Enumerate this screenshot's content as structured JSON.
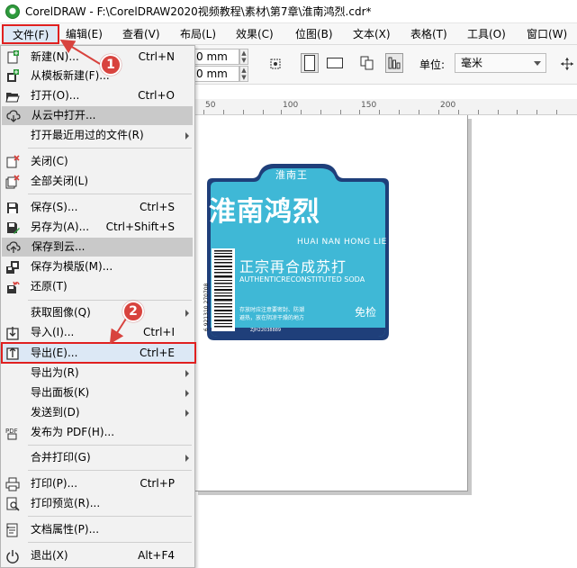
{
  "window": {
    "title": "CorelDRAW - F:\\CorelDRAW2020视频教程\\素材\\第7章\\淮南鸿烈.cdr*"
  },
  "menubar": {
    "items": [
      {
        "label": "文件(F)"
      },
      {
        "label": "编辑(E)"
      },
      {
        "label": "查看(V)"
      },
      {
        "label": "布局(L)"
      },
      {
        "label": "效果(C)"
      },
      {
        "label": "位图(B)"
      },
      {
        "label": "文本(X)"
      },
      {
        "label": "表格(T)"
      },
      {
        "label": "工具(O)"
      },
      {
        "label": "窗口(W)"
      }
    ]
  },
  "toolbar": {
    "width_value": "0 mm",
    "height_value": "0 mm",
    "unit_label": "单位:",
    "unit_value": "毫米"
  },
  "ruler": {
    "labels": [
      "50",
      "100",
      "150",
      "200"
    ]
  },
  "file_menu": {
    "items": [
      {
        "label": "新建(N)...",
        "shortcut": "Ctrl+N",
        "icon": "new-document-icon"
      },
      {
        "label": "从模板新建(F)...",
        "shortcut": "",
        "icon": "new-from-template-icon"
      },
      {
        "label": "打开(O)...",
        "shortcut": "Ctrl+O",
        "icon": "open-folder-icon"
      },
      {
        "label": "从云中打开...",
        "shortcut": "",
        "icon": "cloud-download-icon"
      },
      {
        "label": "打开最近用过的文件(R)",
        "shortcut": "",
        "icon": ""
      },
      {
        "label": "关闭(C)",
        "shortcut": "",
        "icon": "close-document-icon"
      },
      {
        "label": "全部关闭(L)",
        "shortcut": "",
        "icon": "close-all-icon"
      },
      {
        "label": "保存(S)...",
        "shortcut": "Ctrl+S",
        "icon": "save-icon"
      },
      {
        "label": "另存为(A)...",
        "shortcut": "Ctrl+Shift+S",
        "icon": "save-as-icon"
      },
      {
        "label": "保存到云...",
        "shortcut": "",
        "icon": "cloud-upload-icon"
      },
      {
        "label": "保存为模版(M)...",
        "shortcut": "",
        "icon": "save-template-icon"
      },
      {
        "label": "还原(T)",
        "shortcut": "",
        "icon": "revert-icon"
      },
      {
        "label": "获取图像(Q)",
        "shortcut": "",
        "icon": ""
      },
      {
        "label": "导入(I)...",
        "shortcut": "Ctrl+I",
        "icon": "import-icon"
      },
      {
        "label": "导出(E)...",
        "shortcut": "Ctrl+E",
        "icon": "export-icon"
      },
      {
        "label": "导出为(R)",
        "shortcut": "",
        "icon": ""
      },
      {
        "label": "导出面板(K)",
        "shortcut": "",
        "icon": ""
      },
      {
        "label": "发送到(D)",
        "shortcut": "",
        "icon": ""
      },
      {
        "label": "发布为 PDF(H)...",
        "shortcut": "",
        "icon": "pdf-icon"
      },
      {
        "label": "合并打印(G)",
        "shortcut": "",
        "icon": ""
      },
      {
        "label": "打印(P)...",
        "shortcut": "Ctrl+P",
        "icon": "print-icon"
      },
      {
        "label": "打印预览(R)...",
        "shortcut": "",
        "icon": "print-preview-icon"
      },
      {
        "label": "文档属性(P)...",
        "shortcut": "",
        "icon": "document-properties-icon"
      },
      {
        "label": "退出(X)",
        "shortcut": "Alt+F4",
        "icon": "exit-icon"
      }
    ]
  },
  "callouts": {
    "step1": "1",
    "step2": "2"
  },
  "artwork": {
    "brand_small": "淮南王",
    "brand_big": "淮南鸿烈",
    "pinyin": "HUAI NAN HONG LIE",
    "slogan": "正宗再合成苏打",
    "slogan_en": "AUTHENTICRECONSTITUTED SODA",
    "notice": "存放时应注意要密封、防潮\n避热，放在阴凉干燥的地方",
    "badge": "免检",
    "license": "ZJH22038889",
    "barcode_number": "6 921310 270708"
  },
  "colors": {
    "accent_red": "#e02020",
    "badge_red": "#d8433e",
    "label_cyan": "#3fb8d6",
    "label_navy": "#1f3f7a"
  }
}
